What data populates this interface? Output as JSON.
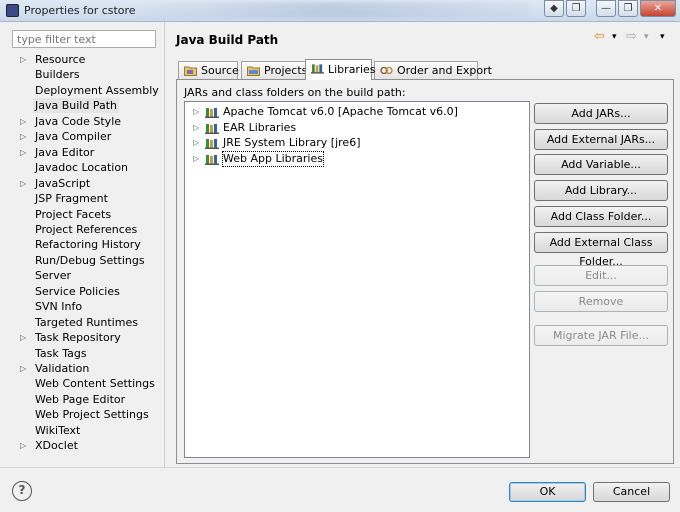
{
  "window": {
    "title": "Properties for cstore",
    "controls": [
      "◆",
      "❐",
      "—",
      "❐",
      "✕"
    ]
  },
  "filter": {
    "placeholder": "type filter text"
  },
  "sidebar": {
    "items": [
      {
        "label": "Resource",
        "expandable": true
      },
      {
        "label": "Builders",
        "expandable": false
      },
      {
        "label": "Deployment Assembly",
        "expandable": false
      },
      {
        "label": "Java Build Path",
        "expandable": false,
        "selected": true
      },
      {
        "label": "Java Code Style",
        "expandable": true
      },
      {
        "label": "Java Compiler",
        "expandable": true
      },
      {
        "label": "Java Editor",
        "expandable": true
      },
      {
        "label": "Javadoc Location",
        "expandable": false
      },
      {
        "label": "JavaScript",
        "expandable": true
      },
      {
        "label": "JSP Fragment",
        "expandable": false
      },
      {
        "label": "Project Facets",
        "expandable": false
      },
      {
        "label": "Project References",
        "expandable": false
      },
      {
        "label": "Refactoring History",
        "expandable": false
      },
      {
        "label": "Run/Debug Settings",
        "expandable": false
      },
      {
        "label": "Server",
        "expandable": false
      },
      {
        "label": "Service Policies",
        "expandable": false
      },
      {
        "label": "SVN Info",
        "expandable": false
      },
      {
        "label": "Targeted Runtimes",
        "expandable": false
      },
      {
        "label": "Task Repository",
        "expandable": true
      },
      {
        "label": "Task Tags",
        "expandable": false
      },
      {
        "label": "Validation",
        "expandable": true
      },
      {
        "label": "Web Content Settings",
        "expandable": false
      },
      {
        "label": "Web Page Editor",
        "expandable": false
      },
      {
        "label": "Web Project Settings",
        "expandable": false
      },
      {
        "label": "WikiText",
        "expandable": false
      },
      {
        "label": "XDoclet",
        "expandable": true
      }
    ]
  },
  "main": {
    "title": "Java Build Path",
    "nav": {
      "back": "⇦",
      "back_menu": "▾",
      "forward": "⇨",
      "forward_menu": "▾",
      "view_menu": "▾"
    },
    "tabs": [
      {
        "label": "Source",
        "icon": "source-folder-icon"
      },
      {
        "label": "Projects",
        "icon": "projects-icon"
      },
      {
        "label": "Libraries",
        "icon": "libraries-icon",
        "active": true
      },
      {
        "label": "Order and Export",
        "icon": "order-export-icon"
      }
    ],
    "jars_label": "JARs and class folders on the build path:",
    "libraries": [
      {
        "label": "Apache Tomcat v6.0 [Apache Tomcat v6.0]"
      },
      {
        "label": "EAR Libraries"
      },
      {
        "label": "JRE System Library [jre6]"
      },
      {
        "label": "Web App Libraries",
        "focused": true
      }
    ],
    "buttons": {
      "add_jars": "Add JARs...",
      "add_external_jars": "Add External JARs...",
      "add_variable": "Add Variable...",
      "add_library": "Add Library...",
      "add_class_folder": "Add Class Folder...",
      "add_external_class_folder": "Add External Class Folder...",
      "edit": "Edit...",
      "remove": "Remove",
      "migrate_jar": "Migrate JAR File..."
    }
  },
  "footer": {
    "help": "?",
    "ok": "OK",
    "cancel": "Cancel"
  },
  "colors": {
    "selection": "#e5e5e5",
    "default_button_border": "#3c7fb1",
    "library_icon": "#3d8b3d"
  }
}
